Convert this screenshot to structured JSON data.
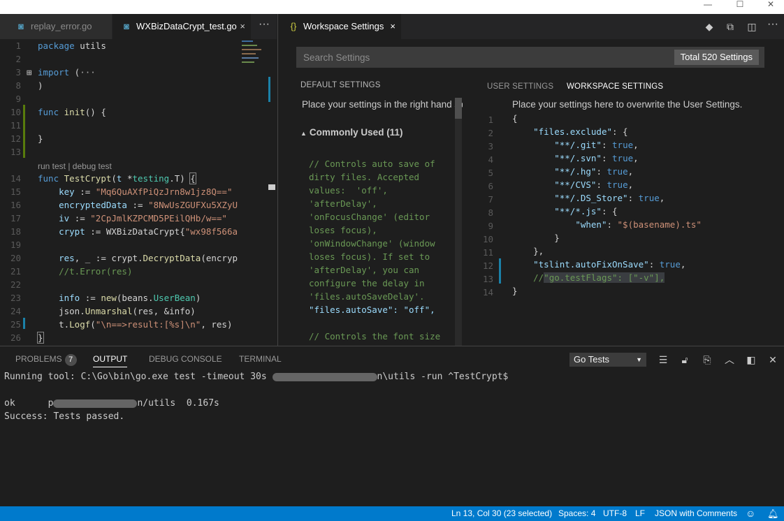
{
  "left_tabs": [
    {
      "icon": "go-file-icon",
      "label": "replay_error.go"
    },
    {
      "icon": "go-file-icon",
      "label": "WXBizDataCrypt_test.go",
      "close": "×"
    }
  ],
  "more_label": "···",
  "code_lines": [
    {
      "n": "1",
      "text": "package utils"
    },
    {
      "n": "2",
      "text": ""
    },
    {
      "n": "3",
      "text": "import (···"
    },
    {
      "n": "8",
      "text": ")"
    },
    {
      "n": "9",
      "text": ""
    },
    {
      "n": "10",
      "text": "func init() {"
    },
    {
      "n": "11",
      "text": ""
    },
    {
      "n": "12",
      "text": "}"
    },
    {
      "n": "13",
      "text": ""
    },
    {
      "n": "14",
      "text": "func TestCrypt(t *testing.T) {"
    },
    {
      "n": "15",
      "text": "    key := \"Mq6QuAXfPiQzJrn8w1jz8Q==\""
    },
    {
      "n": "16",
      "text": "    encryptedData := \"8NwUsZGUFXu5XZyU"
    },
    {
      "n": "17",
      "text": "    iv := \"2CpJmlKZPCMD5PEilQHb/w==\""
    },
    {
      "n": "18",
      "text": "    crypt := WXBizDataCrypt{\"wx98f566a"
    },
    {
      "n": "19",
      "text": ""
    },
    {
      "n": "20",
      "text": "    res, _ := crypt.DecryptData(encryp"
    },
    {
      "n": "21",
      "text": "    //t.Error(res)"
    },
    {
      "n": "22",
      "text": ""
    },
    {
      "n": "23",
      "text": "    info := new(beans.UserBean)"
    },
    {
      "n": "24",
      "text": "    json.Unmarshal(res, &info)"
    },
    {
      "n": "25",
      "text": "    t.Logf(\"\\n==>result:[%s]\\n\", res)"
    },
    {
      "n": "26",
      "text": "}"
    }
  ],
  "codelens": "run test | debug test",
  "settings_tab": {
    "icon": "{}",
    "label": "Workspace Settings",
    "close": "×"
  },
  "search": {
    "placeholder": "Search Settings",
    "total": "Total 520 Settings"
  },
  "default_settings": {
    "header": "DEFAULT SETTINGS",
    "description": "Place your settings in the right hand side",
    "section": "Commonly Used (11)",
    "lines": [
      "// Controls auto save of",
      "dirty files. Accepted",
      "values:  'off',",
      "'afterDelay',",
      "'onFocusChange' (editor",
      "loses focus),",
      "'onWindowChange' (window",
      "loses focus). If set to",
      "'afterDelay', you can",
      "configure the delay in",
      "'files.autoSaveDelay'.",
      "\"files.autoSave\": \"off\",",
      "",
      "// Controls the font size"
    ]
  },
  "user_tabs": [
    "USER SETTINGS",
    "WORKSPACE SETTINGS"
  ],
  "workspace_description": "Place your settings here to overwrite the User Settings.",
  "json_lines": [
    {
      "n": "1",
      "text": "{"
    },
    {
      "n": "2",
      "text": "    \"files.exclude\": {"
    },
    {
      "n": "3",
      "text": "        \"**/.git\": true,"
    },
    {
      "n": "4",
      "text": "        \"**/.svn\": true,"
    },
    {
      "n": "5",
      "text": "        \"**/.hg\": true,"
    },
    {
      "n": "6",
      "text": "        \"**/CVS\": true,"
    },
    {
      "n": "7",
      "text": "        \"**/.DS_Store\": true,"
    },
    {
      "n": "8",
      "text": "        \"**/*.js\": {"
    },
    {
      "n": "9",
      "text": "            \"when\": \"$(basename).ts\""
    },
    {
      "n": "10",
      "text": "        }"
    },
    {
      "n": "11",
      "text": "    },"
    },
    {
      "n": "12",
      "text": "    \"tslint.autoFixOnSave\": true,"
    },
    {
      "n": "13",
      "text": "    //\"go.testFlags\": [\"-v\"],"
    },
    {
      "n": "14",
      "text": "}"
    }
  ],
  "panel_tabs": [
    {
      "label": "PROBLEMS",
      "badge": "7"
    },
    {
      "label": "OUTPUT"
    },
    {
      "label": "DEBUG CONSOLE"
    },
    {
      "label": "TERMINAL"
    }
  ],
  "channel": "Go Tests",
  "output": {
    "line1_a": "Running tool: C:\\Go\\bin\\go.exe test -timeout 30s ",
    "line1_b": "n\\utils -run ^TestCrypt$",
    "line2_a": "ok      p",
    "line2_b": "n/utils  0.167s",
    "line3": "Success: Tests passed."
  },
  "status": {
    "position": "Ln 13, Col 30 (23 selected)",
    "spaces": "Spaces: 4",
    "encoding": "UTF-8",
    "eol": "LF",
    "language": "JSON with Comments"
  }
}
